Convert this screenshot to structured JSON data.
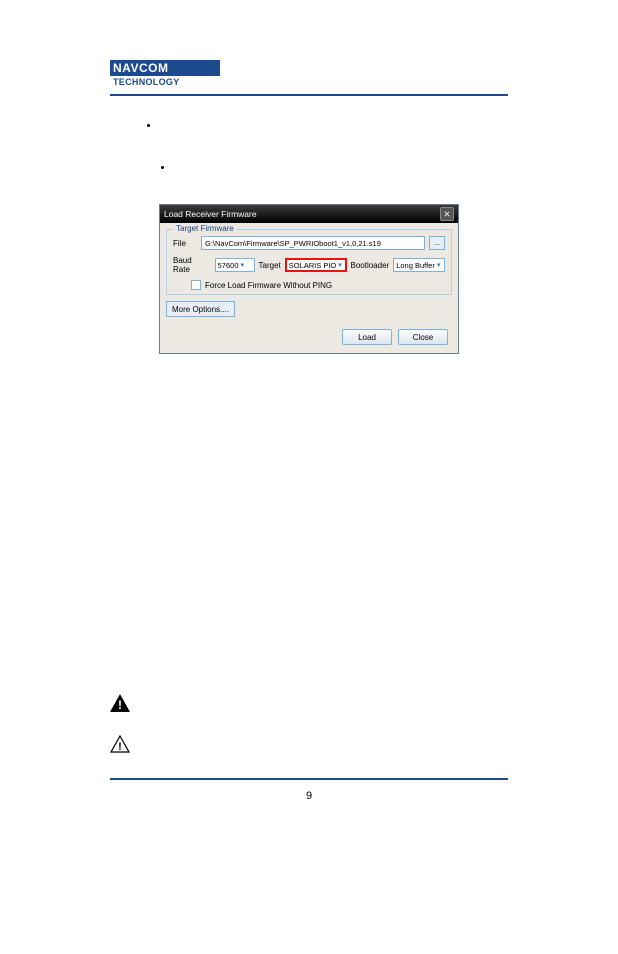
{
  "logo_text": "NAVCOM TECHNOLOGY",
  "bullets": [
    "",
    ""
  ],
  "dialog": {
    "title": "Load Receiver Firmware",
    "fieldset_legend": "Target Firmware",
    "file_label": "File",
    "file_value": "G:\\NavCom\\Firmware\\SP_PWRIOboot1_v1,0,21.s19",
    "baud_label": "Baud Rate",
    "baud_value": "57600",
    "target_label": "Target",
    "target_value": "SOLARIS PIO",
    "bootloader_label": "Bootloader",
    "bootloader_value": "Long Buffer",
    "force_label": "Force Load Firmware Without PING",
    "more_options": "More Options....",
    "load_btn": "Load",
    "close_btn": "Close"
  },
  "page": "9"
}
